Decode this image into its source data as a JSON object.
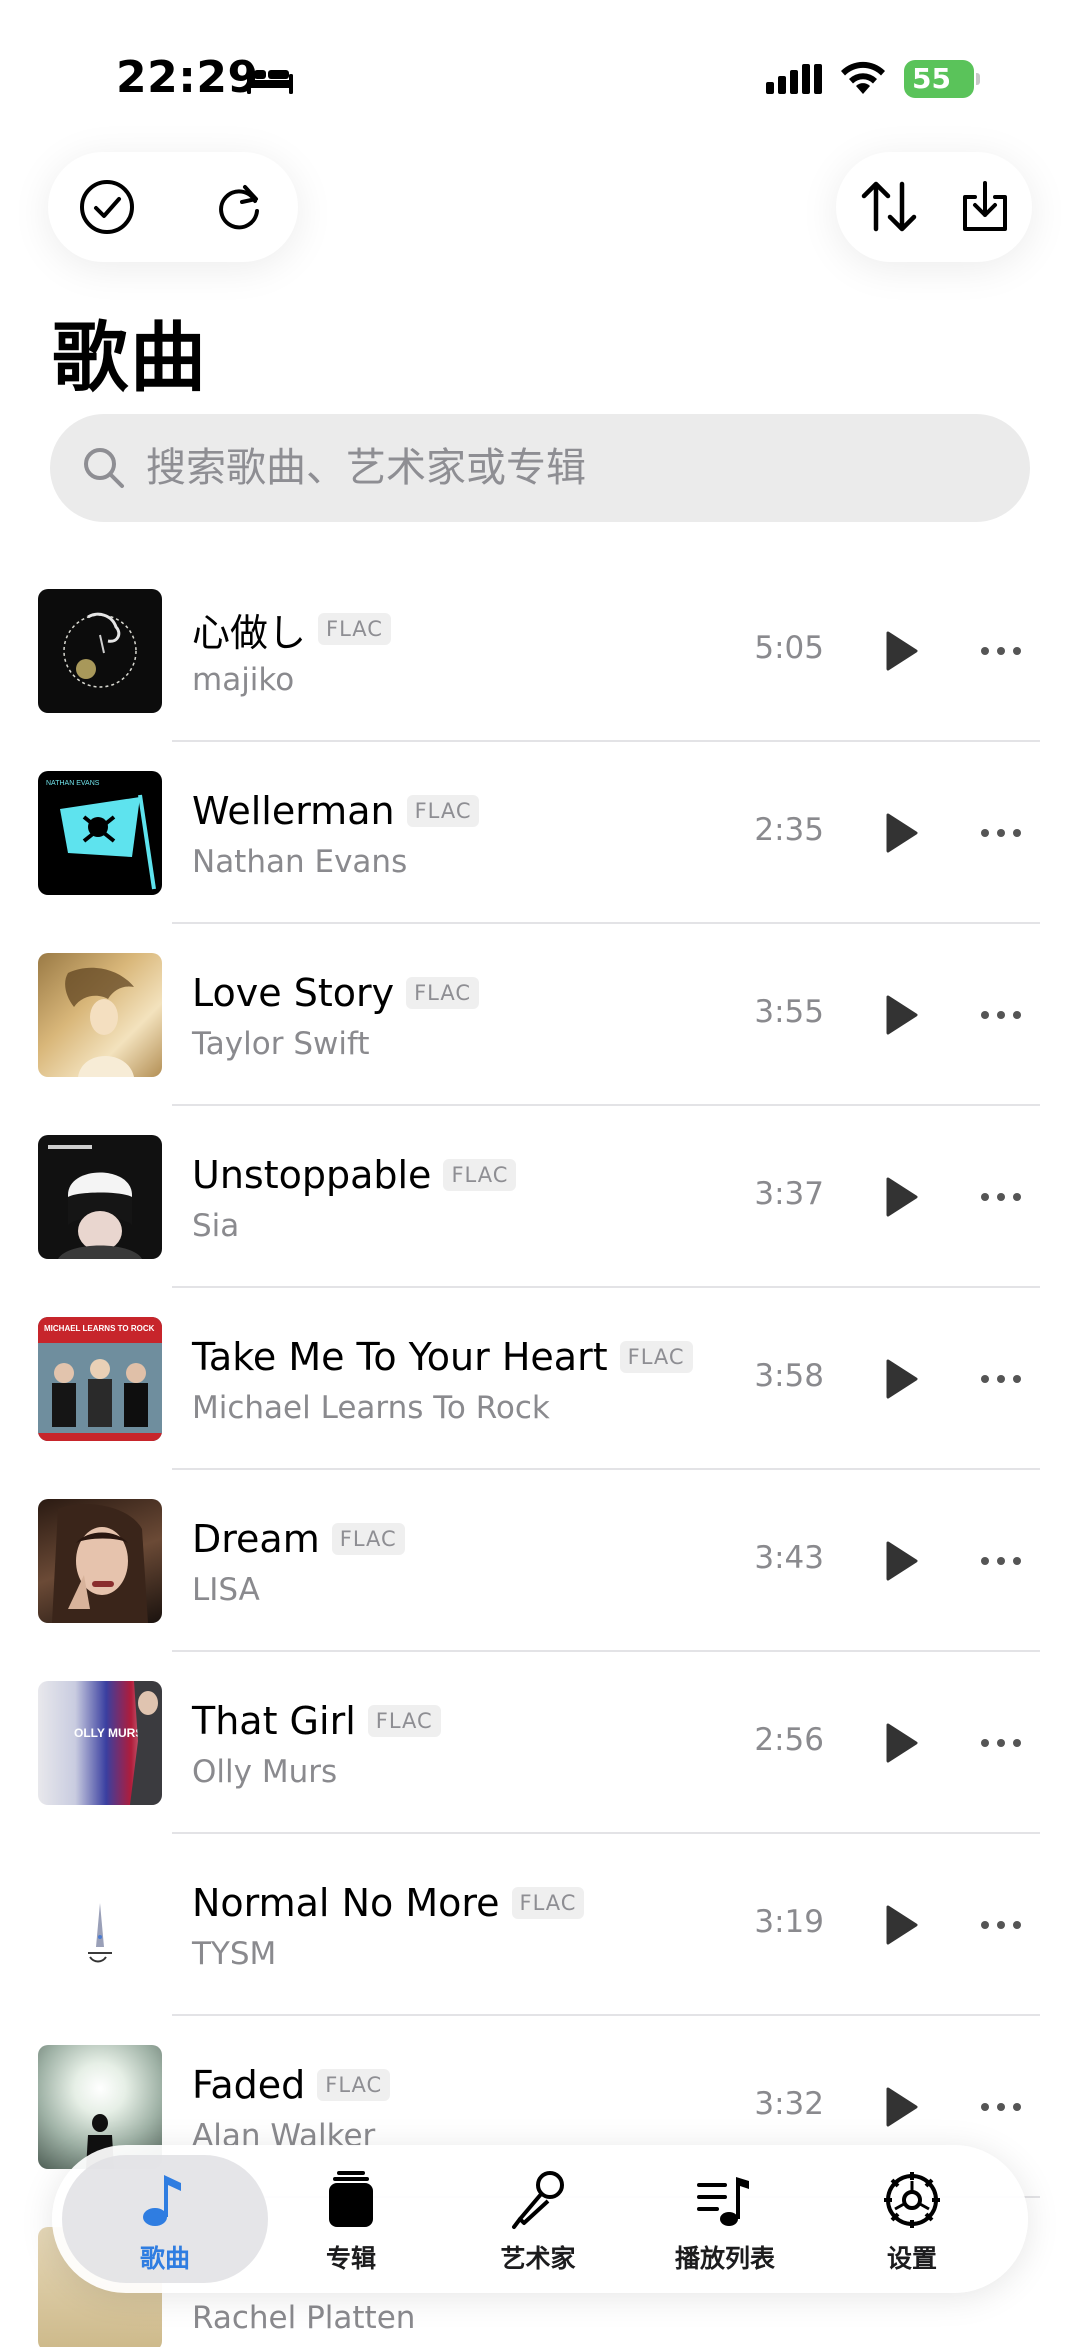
{
  "status_bar": {
    "time": "22:29",
    "battery": "55"
  },
  "page": {
    "title": "歌曲"
  },
  "search": {
    "placeholder": "搜索歌曲、艺术家或专辑"
  },
  "songs": [
    {
      "title": "心做し",
      "badge": "FLAC",
      "artist": "majiko",
      "duration": "5:05"
    },
    {
      "title": "Wellerman",
      "badge": "FLAC",
      "artist": "Nathan Evans",
      "duration": "2:35",
      "cover_text": "NATHAN EVANS"
    },
    {
      "title": "Love Story",
      "badge": "FLAC",
      "artist": "Taylor Swift",
      "duration": "3:55"
    },
    {
      "title": "Unstoppable",
      "badge": "FLAC",
      "artist": "Sia",
      "duration": "3:37"
    },
    {
      "title": "Take Me To Your Heart",
      "badge": "FLAC",
      "artist": "Michael Learns To Rock",
      "duration": "3:58",
      "cover_text": "MICHAEL LEARNS TO ROCK"
    },
    {
      "title": "Dream",
      "badge": "FLAC",
      "artist": "LISA",
      "duration": "3:43"
    },
    {
      "title": "That Girl",
      "badge": "FLAC",
      "artist": "Olly Murs",
      "duration": "2:56",
      "cover_text": "OLLY MURS"
    },
    {
      "title": "Normal No More",
      "badge": "FLAC",
      "artist": "TYSM",
      "duration": "3:19"
    },
    {
      "title": "Faded",
      "badge": "FLAC",
      "artist": "Alan Walker",
      "duration": "3:32"
    },
    {
      "title": "",
      "badge": "",
      "artist": "Rachel Platten",
      "duration": ""
    }
  ],
  "tabs": [
    {
      "label": "歌曲",
      "icon": "music-note-icon",
      "active": true
    },
    {
      "label": "专辑",
      "icon": "album-stack-icon",
      "active": false
    },
    {
      "label": "艺术家",
      "icon": "microphone-icon",
      "active": false
    },
    {
      "label": "播放列表",
      "icon": "playlist-icon",
      "active": false
    },
    {
      "label": "设置",
      "icon": "gear-icon",
      "active": false
    }
  ],
  "colors": {
    "accent": "#2f7de1",
    "battery": "#5ac35a"
  }
}
